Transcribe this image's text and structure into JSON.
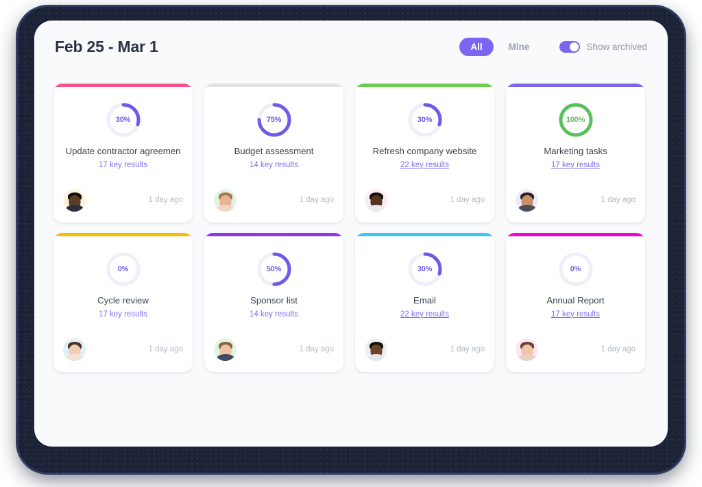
{
  "header": {
    "title": "Feb 25 - Mar 1",
    "filters": [
      {
        "label": "All",
        "active": true
      },
      {
        "label": "Mine",
        "active": false
      }
    ],
    "show_archived_label": "Show archived",
    "show_archived_on": true,
    "accent_color": "#7a66f0"
  },
  "colors": {
    "panel_bg": "#f8fafc",
    "bezel": "#1b2236",
    "ring_track": "#f0eefb",
    "ring_progress": "#6c5ce7",
    "ring_complete": "#5bc25b",
    "title_text": "#2b3242",
    "link_text": "#7d6ff0",
    "timestamp_text": "#b3b9c4"
  },
  "cards": [
    {
      "title": "Update contractor agreemen",
      "key_results": "17 key results",
      "underlined": false,
      "percent": 30,
      "percent_label": "30%",
      "accent": "#f9508f",
      "timestamp": "1 day ago",
      "avatar": {
        "bg": "#fdf3dd",
        "skin": "#5b3a26",
        "hair": "#120d0a",
        "shirt": "#2b2f3a"
      }
    },
    {
      "title": "Budget assessment",
      "key_results": "14 key results",
      "underlined": false,
      "percent": 75,
      "percent_label": "75%",
      "accent": "#e2e2e2",
      "timestamp": "1 day ago",
      "avatar": {
        "bg": "#e3f3e6",
        "skin": "#e6b594",
        "hair": "#a9774d",
        "shirt": "#f0d8c8"
      }
    },
    {
      "title": "Refresh company website",
      "key_results": "22 key results",
      "underlined": true,
      "percent": 30,
      "percent_label": "30%",
      "accent": "#6ccf4a",
      "timestamp": "1 day ago",
      "avatar": {
        "bg": "#fdeaf2",
        "skin": "#56331f",
        "hair": "#15100c",
        "shirt": "#e9eaee"
      }
    },
    {
      "title": "Marketing tasks",
      "key_results": "17 key results",
      "underlined": true,
      "percent": 100,
      "percent_label": "100%",
      "accent": "#7b68ee",
      "timestamp": "1 day ago",
      "avatar": {
        "bg": "#efeafb",
        "skin": "#c98f6a",
        "hair": "#2a211c",
        "shirt": "#4a4f5c"
      }
    },
    {
      "title": "Cycle review",
      "key_results": "17 key results",
      "underlined": false,
      "percent": 0,
      "percent_label": "0%",
      "accent": "#fbbc05",
      "timestamp": "1 day ago",
      "avatar": {
        "bg": "#dff0fb",
        "skin": "#f0cdb4",
        "hair": "#4b2f22",
        "shirt": "#f2e2d6"
      }
    },
    {
      "title": "Sponsor list",
      "key_results": "14 key results",
      "underlined": false,
      "percent": 50,
      "percent_label": "50%",
      "accent": "#9333ea",
      "timestamp": "1 day ago",
      "avatar": {
        "bg": "#e3f3e6",
        "skin": "#eec3a2",
        "hair": "#8a6442",
        "shirt": "#3c4a63"
      }
    },
    {
      "title": "Email",
      "key_results": "22 key results",
      "underlined": true,
      "percent": 30,
      "percent_label": "30%",
      "accent": "#3bc9f0",
      "timestamp": "1 day ago",
      "avatar": {
        "bg": "#eef0f4",
        "skin": "#6b4328",
        "hair": "#14100d",
        "shirt": "#e4e6ea"
      }
    },
    {
      "title": "Annual Report",
      "key_results": "17 key results",
      "underlined": true,
      "percent": 0,
      "percent_label": "0%",
      "accent": "#ff00c8",
      "timestamp": "1 day ago",
      "avatar": {
        "bg": "#fbe7f1",
        "skin": "#f1c4a6",
        "hair": "#6d3f2c",
        "shirt": "#e9d2c4"
      }
    }
  ]
}
